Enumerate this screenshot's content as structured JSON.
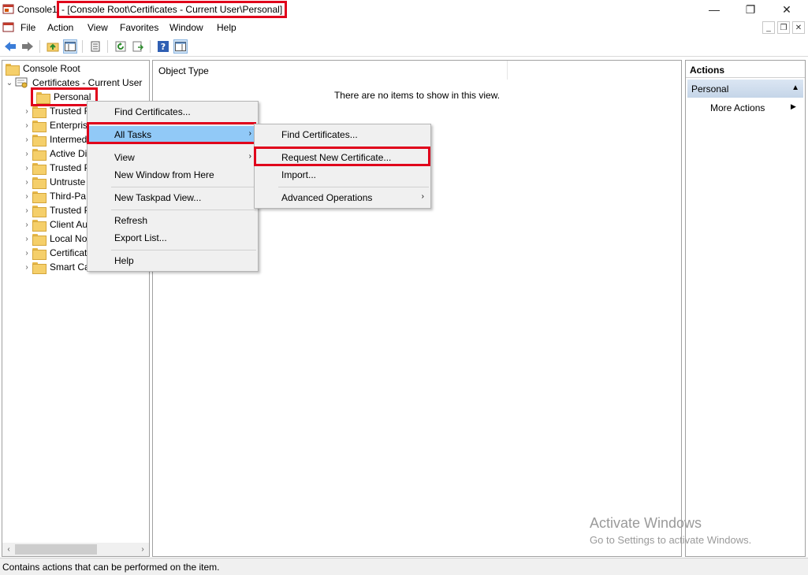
{
  "window": {
    "title_prefix": "Console1",
    "title_path": "- [Console Root\\Certificates - Current User\\Personal]",
    "controls": {
      "minimize": "—",
      "restore": "❐",
      "close": "✕"
    }
  },
  "menubar": {
    "items": [
      "File",
      "Action",
      "View",
      "Favorites",
      "Window",
      "Help"
    ],
    "mdi": {
      "minimize": "_",
      "restore": "❐",
      "close": "✕"
    }
  },
  "toolbar": {
    "icons": [
      "back-arrow-icon",
      "forward-arrow-icon",
      "up-folder-icon",
      "show-hide-tree-icon",
      "properties-icon",
      "refresh-icon",
      "export-list-icon",
      "help-icon",
      "show-hide-action-pane-icon"
    ]
  },
  "tree": {
    "root": "Console Root",
    "snapin": "Certificates - Current User",
    "items": [
      "Personal",
      "Trusted R",
      "Enterpris",
      "Intermed",
      "Active Di",
      "Trusted P",
      "Untruste",
      "Third-Pa",
      "Trusted P",
      "Client Au",
      "Local No",
      "Certificat",
      "Smart Ca"
    ]
  },
  "center": {
    "column_header": "Object Type",
    "empty_message": "There are no items to show in this view."
  },
  "actions": {
    "title": "Actions",
    "section": "Personal",
    "items": [
      "More Actions"
    ]
  },
  "context_menu": {
    "items": [
      "Find Certificates...",
      "All Tasks",
      "View",
      "New Window from Here",
      "New Taskpad View...",
      "Refresh",
      "Export List...",
      "Help"
    ]
  },
  "submenu": {
    "items": [
      "Find Certificates...",
      "Request New Certificate...",
      "Import...",
      "Advanced Operations"
    ]
  },
  "watermark": {
    "line1": "Activate Windows",
    "line2": "Go to Settings to activate Windows."
  },
  "status": {
    "text": "Contains actions that can be performed on the item."
  },
  "colors": {
    "highlight_box": "#e0001b",
    "menu_selection": "#91c9f7",
    "folder": "#f5cf6a"
  }
}
